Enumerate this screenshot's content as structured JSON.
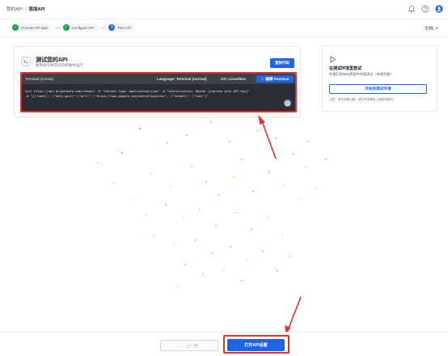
{
  "header": {
    "breadcrumb_root": "我的API",
    "breadcrumb_sep": "/",
    "breadcrumb_current": "添加API",
    "icons": [
      "bell-icon",
      "help-icon",
      "user-icon"
    ]
  },
  "steps": {
    "items": [
      {
        "label": "Choose API type",
        "status": "done"
      },
      {
        "label": "Configure API",
        "status": "done"
      },
      {
        "label": "Test API",
        "status": "active",
        "number": "3"
      }
    ],
    "docs_label": "文档 ↗"
  },
  "test_card": {
    "title": "测试您的API",
    "subtitle": "复制命令并在您的终端中运行",
    "copy_button": "复制代码",
    "terminal": {
      "title": "Terminal (normal)",
      "language": "Language: Terminal (normal)",
      "os": "OS: Linux/Mac",
      "postman_button": "编辑 Postman",
      "code_line1": "curl https://api.brightdata.com/request -H \"Content-Type: application/json\" -H \"Authorization: Bearer [replace with API key]\"",
      "code_line2": "-d \"{\\\"zone\\\": \\\"serp_api1\\\",\\\"url\\\": \\\"https://www.google.com/search?q=pizza\\\", \\\"format\\\": \\\"raw\\\"}\""
    }
  },
  "side_card": {
    "title": "在测试环境里尝试",
    "subtitle": "在我们的Web界面中快速测试（有限功能）",
    "button": "开始的测试环境",
    "note": "注意：有关完整功能，请打开您最新上面的终端中。"
  },
  "footer": {
    "prev_button": "← 上一步",
    "open_button": "打开API设置"
  },
  "colors": {
    "accent": "#1e64e6",
    "success": "#16a34a",
    "highlight": "#e0302f",
    "terminal_bg": "#2a2d33"
  }
}
